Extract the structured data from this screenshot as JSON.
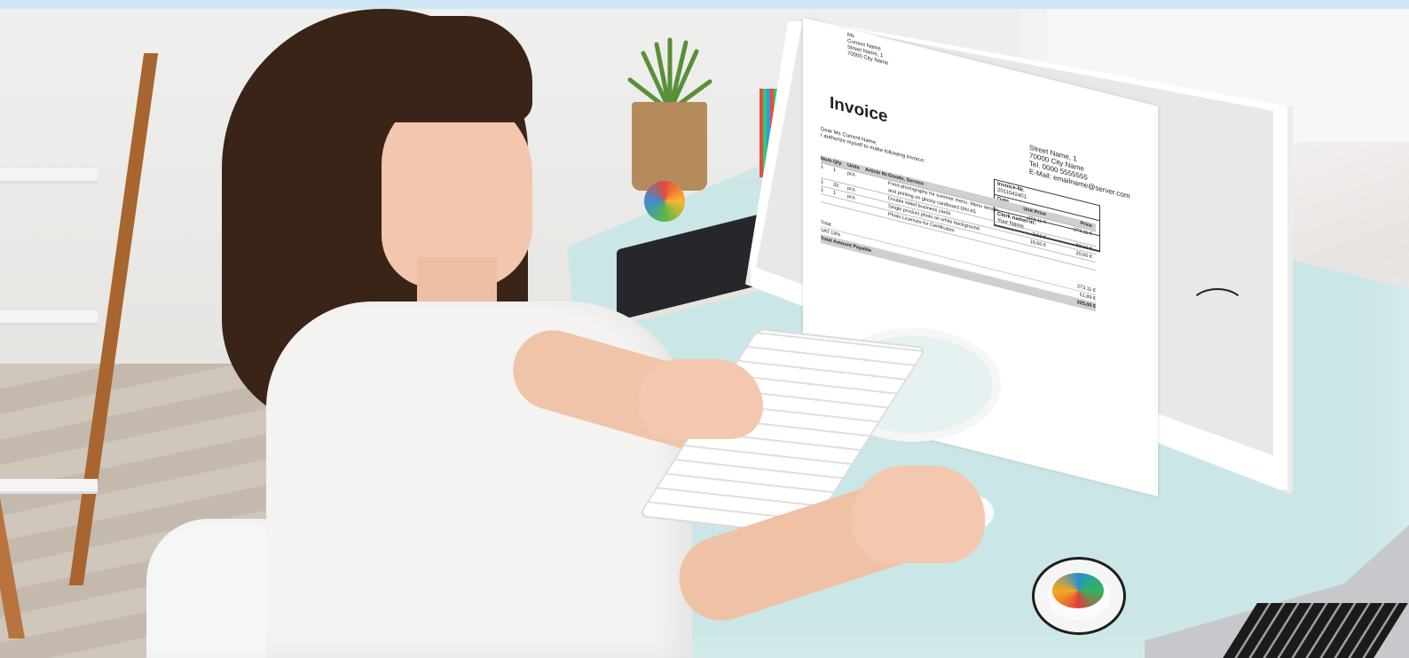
{
  "invoice": {
    "sender_lines": [
      "Ms",
      "Current Name",
      "Street Name, 1",
      "70000 City Name"
    ],
    "title": "Invoice",
    "company_lines": [
      "Street Name, 1",
      "70000 City Name",
      "Tel. 0000 5555555",
      "E-Mail: emailname@server.com"
    ],
    "salutation_lines": [
      "Dear Ms Current Name,",
      "I authorize myself to make following Invoice:"
    ],
    "meta": [
      {
        "label": "Invoice-Nr.",
        "value": "2011042401"
      },
      {
        "label": "Date",
        "value": "24.04.2011"
      },
      {
        "label": "Clerk name/-in:",
        "value": "Your Name"
      }
    ],
    "table_headers": [
      "Num.",
      "Qty.",
      "Units",
      "Article Nr.",
      "Goods, Service",
      "Unit Price",
      "Price"
    ],
    "rows": [
      {
        "num": "1",
        "qty": "1",
        "unit": "pcs.",
        "art": "",
        "goods": "Food photography for summer menu. Menu design and printing on glossy cardboard DIN A5",
        "unit_price": "273,11 €",
        "price": "273,11 €"
      },
      {
        "num": "1",
        "qty": "33",
        "unit": "pcs.",
        "art": "",
        "goods": "Double sided business cards",
        "unit_price": "2,52 €",
        "price": "83,16 €"
      },
      {
        "num": "1",
        "qty": "1",
        "unit": "pcs.",
        "art": "",
        "goods": "Single product photo on white background",
        "unit_price": "16,60 €",
        "price": "20,00 €"
      },
      {
        "num": "",
        "qty": "",
        "unit": "",
        "art": "",
        "goods": "Photo Licenses for Certificates",
        "unit_price": "",
        "price": ""
      }
    ],
    "totals": [
      {
        "label": "Total",
        "value": "273,11 €"
      },
      {
        "label": "VAT 19%",
        "value": "51,89 €"
      },
      {
        "label": "Total Amount Payable",
        "value": "325,00 €"
      }
    ]
  }
}
